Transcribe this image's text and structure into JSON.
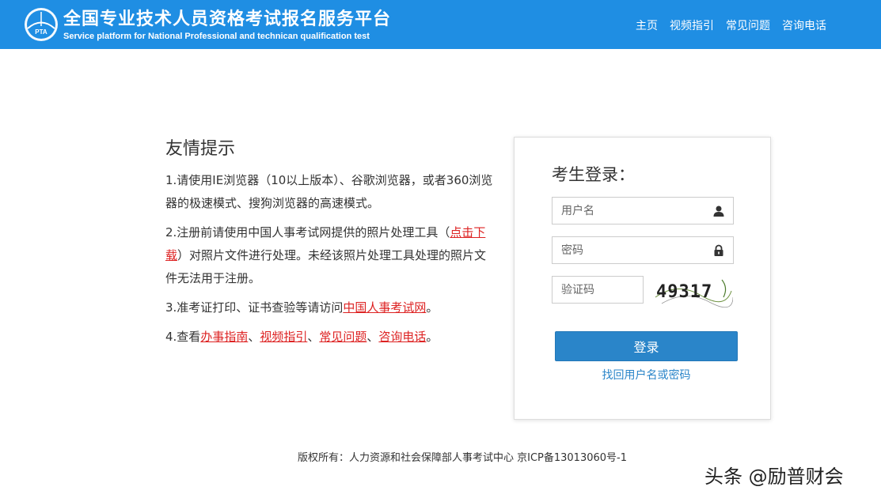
{
  "header": {
    "title": "全国专业技术人员资格考试报名服务平台",
    "subtitle": "Service platform for National Professional and technican qualification test",
    "logo_text": "PTA",
    "nav": [
      "主页",
      "视频指引",
      "常见问题",
      "咨询电话"
    ]
  },
  "tips": {
    "title": "友情提示",
    "tip1": "1.请使用IE浏览器（10以上版本）、谷歌浏览器，或者360浏览器的极速模式、搜狗浏览器的高速模式。",
    "tip2_before": "2.注册前请使用中国人事考试网提供的照片处理工具（",
    "tip2_link": "点击下载",
    "tip2_after": "）对照片文件进行处理。未经该照片处理工具处理的照片文件无法用于注册。",
    "tip3_before": "3.准考证打印、证书查验等请访问",
    "tip3_link": "中国人事考试网",
    "tip3_after": "。",
    "tip4_before": "4.查看",
    "tip4_links": [
      "办事指南",
      "视频指引",
      "常见问题",
      "咨询电话"
    ],
    "tip4_sep": "、",
    "tip4_after": "。"
  },
  "login": {
    "title": "考生登录：",
    "username_placeholder": "用户名",
    "password_placeholder": "密码",
    "captcha_placeholder": "验证码",
    "captcha_text": "49317",
    "button": "登录",
    "forgot": "找回用户名或密码"
  },
  "footer": {
    "copyright": "版权所有：人力资源和社会保障部人事考试中心 京ICP备13013060号-1"
  },
  "watermark": "头条 @励普财会",
  "colors": {
    "header_bg": "#1f8ee3",
    "link_red": "#dd2222",
    "button_blue": "#2a85c9"
  }
}
